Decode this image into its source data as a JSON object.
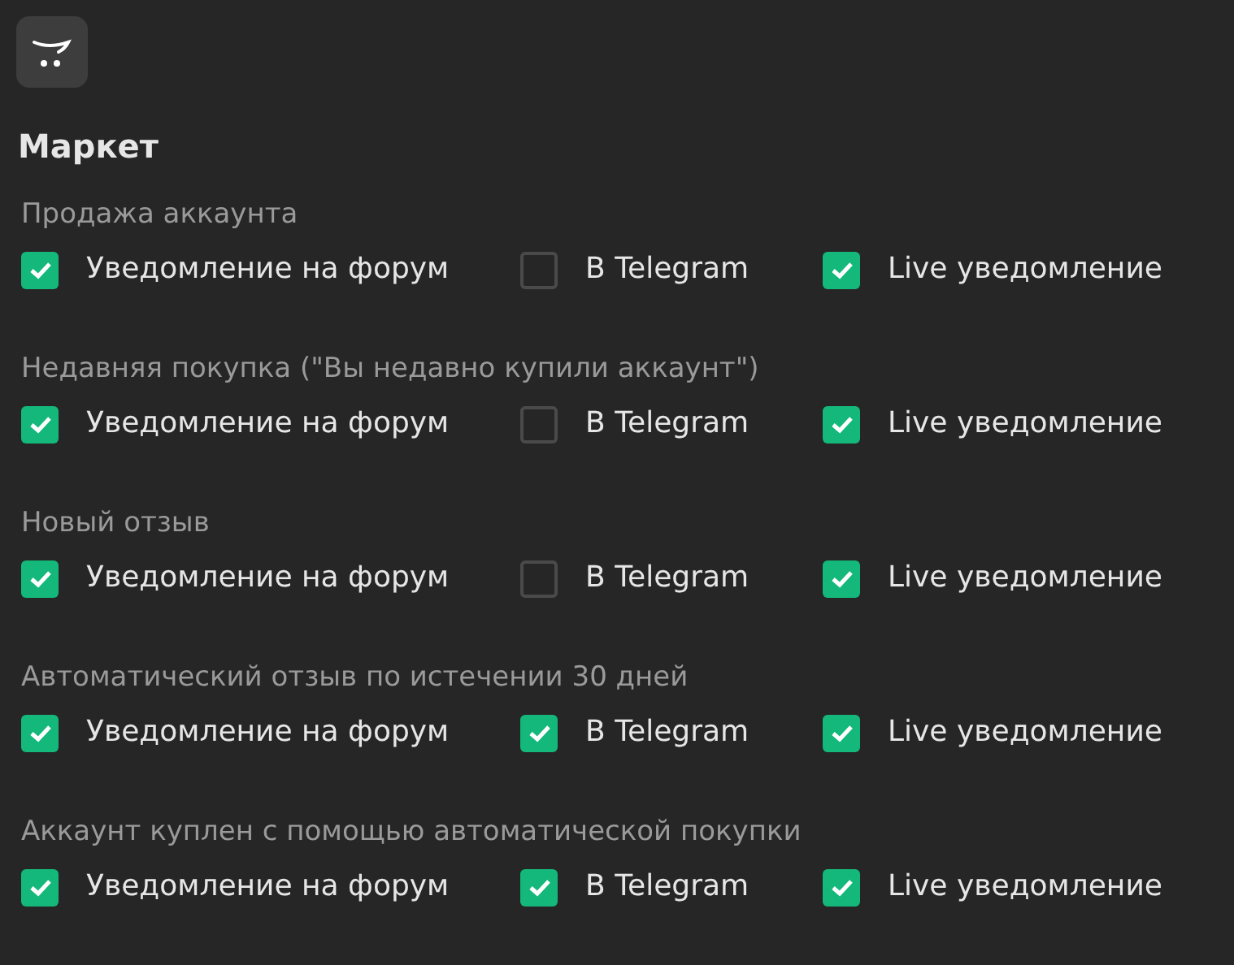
{
  "title": "Маркет",
  "sections": [
    {
      "label": "Продажа аккаунта",
      "options": [
        {
          "label": "Уведомление на форум",
          "checked": true
        },
        {
          "label": "В Telegram",
          "checked": false
        },
        {
          "label": "Live уведомление",
          "checked": true
        }
      ]
    },
    {
      "label": "Недавняя покупка (\"Вы недавно купили аккаунт\")",
      "options": [
        {
          "label": "Уведомление на форум",
          "checked": true
        },
        {
          "label": "В Telegram",
          "checked": false
        },
        {
          "label": "Live уведомление",
          "checked": true
        }
      ]
    },
    {
      "label": "Новый отзыв",
      "options": [
        {
          "label": "Уведомление на форум",
          "checked": true
        },
        {
          "label": "В Telegram",
          "checked": false
        },
        {
          "label": "Live уведомление",
          "checked": true
        }
      ]
    },
    {
      "label": "Автоматический отзыв по истечении 30 дней",
      "options": [
        {
          "label": "Уведомление на форум",
          "checked": true
        },
        {
          "label": "В Telegram",
          "checked": true
        },
        {
          "label": "Live уведомление",
          "checked": true
        }
      ]
    },
    {
      "label": "Аккаунт куплен с помощью автоматической покупки",
      "options": [
        {
          "label": "Уведомление на форум",
          "checked": true
        },
        {
          "label": "В Telegram",
          "checked": true
        },
        {
          "label": "Live уведомление",
          "checked": true
        }
      ]
    }
  ]
}
